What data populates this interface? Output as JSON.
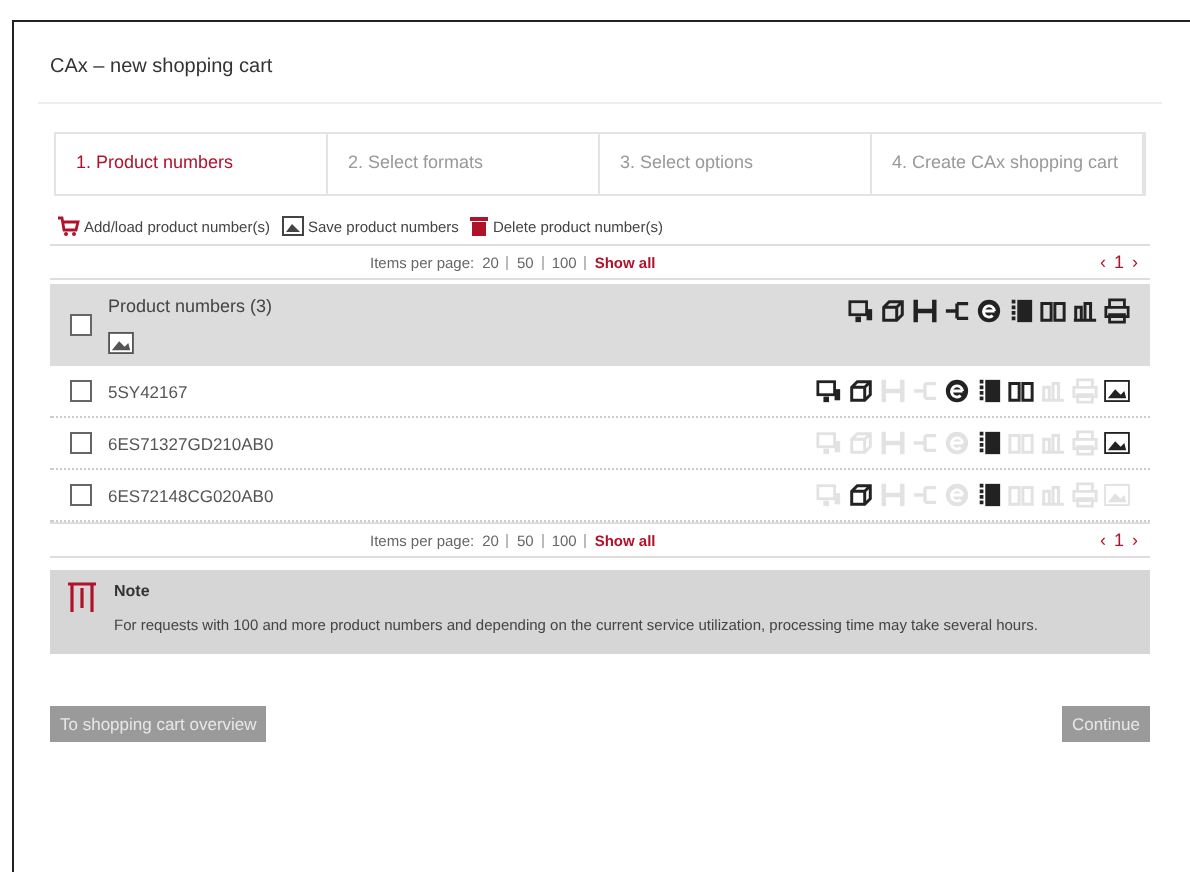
{
  "window": {
    "title": "CAx – new shopping cart"
  },
  "steps": [
    {
      "label": "1. Product numbers",
      "selected": true
    },
    {
      "label": "2. Select formats",
      "selected": false
    },
    {
      "label": "3. Select options",
      "selected": false
    },
    {
      "label": "4. Create CAx shopping cart",
      "selected": false
    }
  ],
  "actions": [
    {
      "kind": "add",
      "label": "Add/load product number(s)"
    },
    {
      "kind": "save",
      "label": "Save product numbers"
    },
    {
      "kind": "delete",
      "label": "Delete product number(s)"
    }
  ],
  "pagers": [
    {
      "label": "Items per page:",
      "options": [
        "20",
        "50",
        "100"
      ],
      "show_all": "Show all",
      "prev": "‹",
      "page": "1",
      "next": "›"
    },
    {
      "label": "Items per page:",
      "options": [
        "20",
        "50",
        "100"
      ],
      "show_all": "Show all",
      "prev": "‹",
      "page": "1",
      "next": "›"
    }
  ],
  "table": {
    "header": {
      "title": "Product numbers (3)",
      "checked": false
    },
    "rows": [
      {
        "number": "5SY42167",
        "checked": false,
        "formats": [
          true,
          true,
          false,
          false,
          true,
          true,
          true,
          false,
          false
        ],
        "preview": true
      },
      {
        "number": "6ES71327GD210AB0",
        "checked": false,
        "formats": [
          false,
          false,
          false,
          false,
          false,
          true,
          false,
          false,
          false
        ],
        "preview": true
      },
      {
        "number": "6ES72148CG020AB0",
        "checked": false,
        "formats": [
          false,
          true,
          false,
          false,
          false,
          true,
          false,
          false,
          false
        ],
        "preview": false
      }
    ]
  },
  "note": {
    "title": "Note",
    "text": "For requests with 100 and more product numbers and depending on the current service utilization, processing time may take several hours."
  },
  "buttons": [
    {
      "label": "To shopping cart overview"
    },
    {
      "label": "Continue"
    }
  ]
}
